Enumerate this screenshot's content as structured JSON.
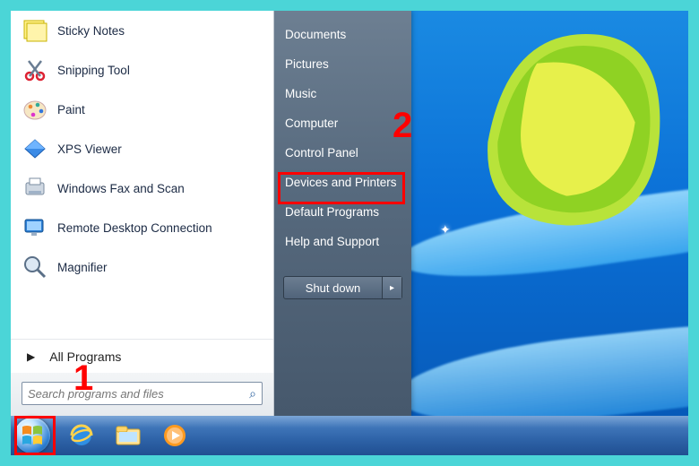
{
  "programs": [
    {
      "label": "Sticky Notes",
      "icon": "sticky-notes-icon"
    },
    {
      "label": "Snipping Tool",
      "icon": "snipping-tool-icon"
    },
    {
      "label": "Paint",
      "icon": "paint-icon"
    },
    {
      "label": "XPS Viewer",
      "icon": "xps-viewer-icon"
    },
    {
      "label": "Windows Fax and Scan",
      "icon": "fax-scan-icon"
    },
    {
      "label": "Remote Desktop Connection",
      "icon": "remote-desktop-icon"
    },
    {
      "label": "Magnifier",
      "icon": "magnifier-icon"
    }
  ],
  "all_programs_label": "All Programs",
  "search": {
    "placeholder": "Search programs and files"
  },
  "right_items": [
    "Documents",
    "Pictures",
    "Music",
    "Computer",
    "Control Panel",
    "Devices and Printers",
    "Default Programs",
    "Help and Support"
  ],
  "shutdown_label": "Shut down",
  "taskbar": [
    {
      "name": "start-orb"
    },
    {
      "name": "internet-explorer-icon"
    },
    {
      "name": "file-explorer-icon"
    },
    {
      "name": "media-player-icon"
    }
  ],
  "annotations": {
    "num1": "1",
    "num2": "2"
  }
}
